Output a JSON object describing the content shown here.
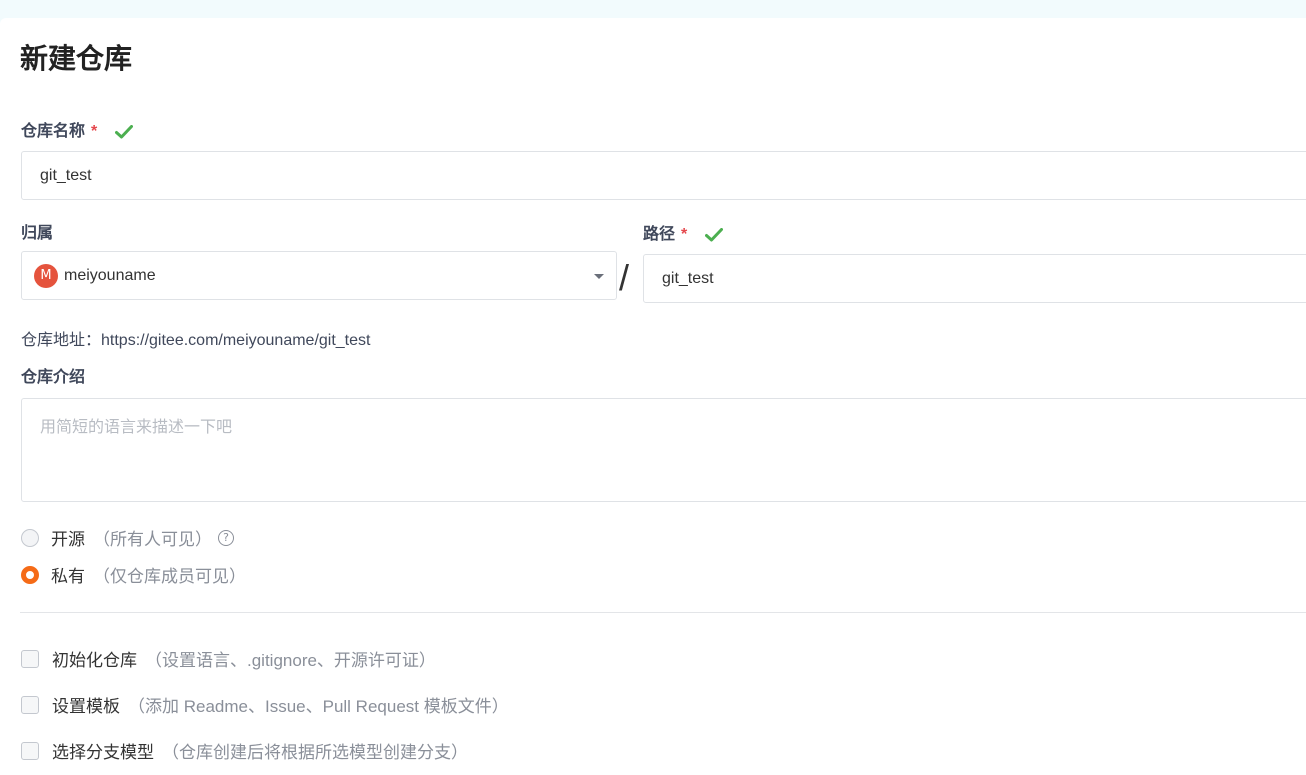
{
  "page": {
    "title": "新建仓库"
  },
  "repo_name": {
    "label": "仓库名称",
    "required": "*",
    "value": "git_test"
  },
  "owner": {
    "label": "归属",
    "avatar_initial": "M",
    "value": "meiyouname"
  },
  "separator": "/",
  "path": {
    "label": "路径",
    "required": "*",
    "value": "git_test"
  },
  "repo_url": {
    "text": "仓库地址：https://gitee.com/meiyouname/git_test"
  },
  "description": {
    "label": "仓库介绍",
    "placeholder": "用简短的语言来描述一下吧"
  },
  "visibility": {
    "options": [
      {
        "label": "开源",
        "hint": "（所有人可见）",
        "help": "?",
        "selected": false
      },
      {
        "label": "私有",
        "hint": "（仅仓库成员可见）",
        "selected": true
      }
    ]
  },
  "options": [
    {
      "label": "初始化仓库",
      "hint": "（设置语言、.gitignore、开源许可证）",
      "checked": false
    },
    {
      "label": "设置模板",
      "hint": "（添加 Readme、Issue、Pull Request 模板文件）",
      "checked": false
    },
    {
      "label": "选择分支模型",
      "hint": "（仓库创建后将根据所选模型创建分支）",
      "checked": false
    }
  ],
  "colors": {
    "accent": "#f56b17",
    "valid": "#4caf50",
    "required": "#e5484d"
  },
  "icons": {
    "valid": "check-icon",
    "dropdown": "caret-down-icon",
    "help": "question-circle-icon"
  }
}
